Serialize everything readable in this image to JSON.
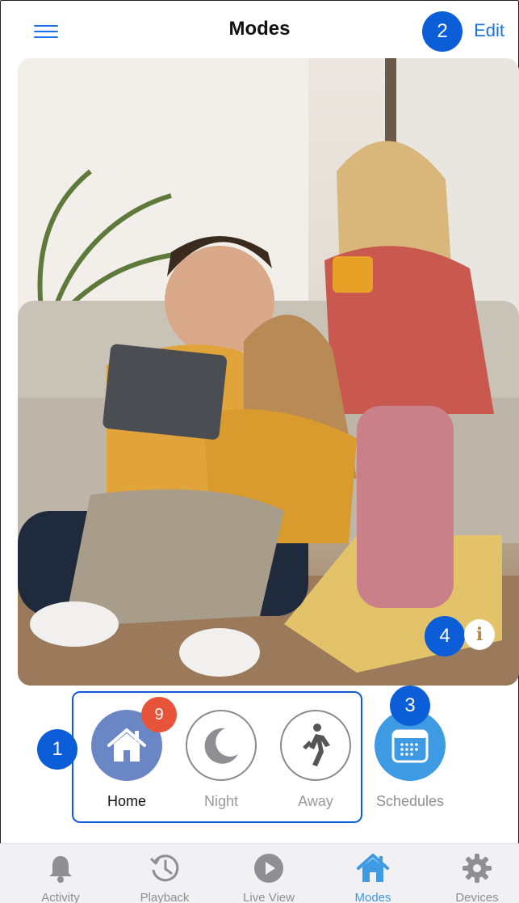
{
  "header": {
    "title": "Modes",
    "edit_label": "Edit"
  },
  "markers": {
    "m1": "1",
    "m2": "2",
    "m3": "3",
    "m4": "4"
  },
  "modes": [
    {
      "label": "Home",
      "active": true,
      "icon": "home-icon",
      "badge": "9"
    },
    {
      "label": "Night",
      "active": false,
      "icon": "moon-icon"
    },
    {
      "label": "Away",
      "active": false,
      "icon": "walking-person-icon"
    }
  ],
  "schedules": {
    "label": "Schedules",
    "icon": "calendar-icon"
  },
  "info": {
    "icon": "info-icon",
    "glyph": "i"
  },
  "tabs": [
    {
      "label": "Activity",
      "icon": "bell-icon",
      "active": false
    },
    {
      "label": "Playback",
      "icon": "history-clock-icon",
      "active": false
    },
    {
      "label": "Live View",
      "icon": "play-icon",
      "active": false
    },
    {
      "label": "Modes",
      "icon": "home-icon",
      "active": true
    },
    {
      "label": "Devices",
      "icon": "gear-icon",
      "active": false
    }
  ],
  "colors": {
    "accent": "#1a73e8",
    "active_mode": "#6b86c4",
    "badge": "#e8543a",
    "schedules": "#3d9ae3",
    "marker": "#0b5ed7"
  }
}
